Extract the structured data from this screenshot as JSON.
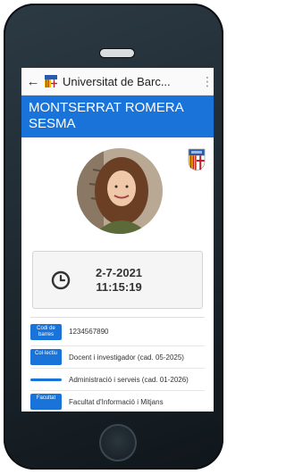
{
  "app": {
    "back_icon": "arrow-left-icon",
    "title": "Universitat de Barc...",
    "menu_icon": "kebab-menu-icon"
  },
  "profile": {
    "name": "MONTSERRAT ROMERA SESMA",
    "accent_color": "#1a73d9"
  },
  "clock": {
    "date": "2-7-2021",
    "time": "11:15:19",
    "icon": "clock-icon"
  },
  "fields": [
    {
      "label": "Codi de barres",
      "value": "1234567890"
    },
    {
      "label": "Col·lectiu",
      "value": "Docent i investigador (cad. 05-2025)"
    },
    {
      "label": "",
      "value": "Administració i serveis (cad. 01-2026)"
    },
    {
      "label": "Facultat",
      "value": "Facultat d'Informació i Mitjans"
    }
  ]
}
